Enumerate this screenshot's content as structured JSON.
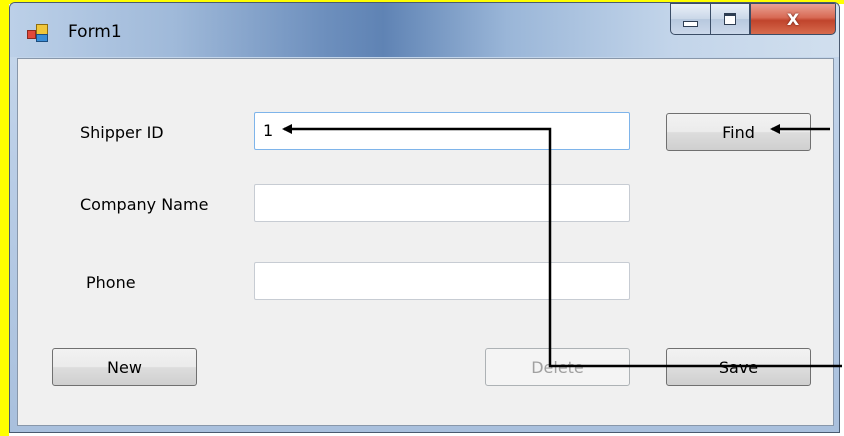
{
  "window": {
    "title": "Form1",
    "close_glyph": "X"
  },
  "form": {
    "shipper_id_label": "Shipper ID",
    "shipper_id_value": "1",
    "company_name_label": "Company Name",
    "company_name_value": "",
    "phone_label": "Phone",
    "phone_value": "",
    "find_label": "Find",
    "new_label": "New",
    "delete_label": "Delete",
    "save_label": "Save"
  },
  "icons": {
    "app": "app-icon",
    "minimize": "minimize-icon",
    "maximize": "maximize-icon",
    "close": "close-icon"
  },
  "colors": {
    "highlight_border": "#ffff00",
    "client_bg": "#f0f0f0",
    "close_button": "#c0442c"
  }
}
